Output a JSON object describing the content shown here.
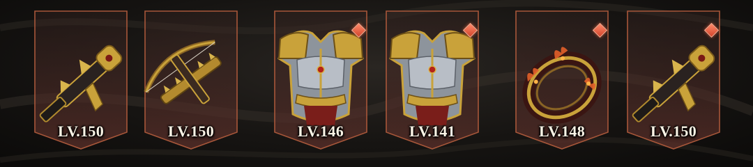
{
  "equipment": {
    "items": [
      {
        "name": "golden pistol",
        "icon": "pistol-icon",
        "level_label": "LV.150",
        "new_badge": false
      },
      {
        "name": "spiked crossbow",
        "icon": "crossbow-icon",
        "level_label": "LV.150",
        "new_badge": false
      },
      {
        "name": "plate chest armor",
        "icon": "chest-armor-icon",
        "level_label": "LV.146",
        "new_badge": true
      },
      {
        "name": "plate chest armor",
        "icon": "chest-armor-icon",
        "level_label": "LV.141",
        "new_badge": true
      },
      {
        "name": "flaming ring",
        "icon": "ring-icon",
        "level_label": "LV.148",
        "new_badge": true
      },
      {
        "name": "golden pistol",
        "icon": "pistol-icon",
        "level_label": "LV.150",
        "new_badge": true
      }
    ]
  },
  "colors": {
    "frame_border": "#a8573a",
    "badge": "#e0563a",
    "level_text": "#fbf4e6",
    "gold": "#c9a23a"
  }
}
